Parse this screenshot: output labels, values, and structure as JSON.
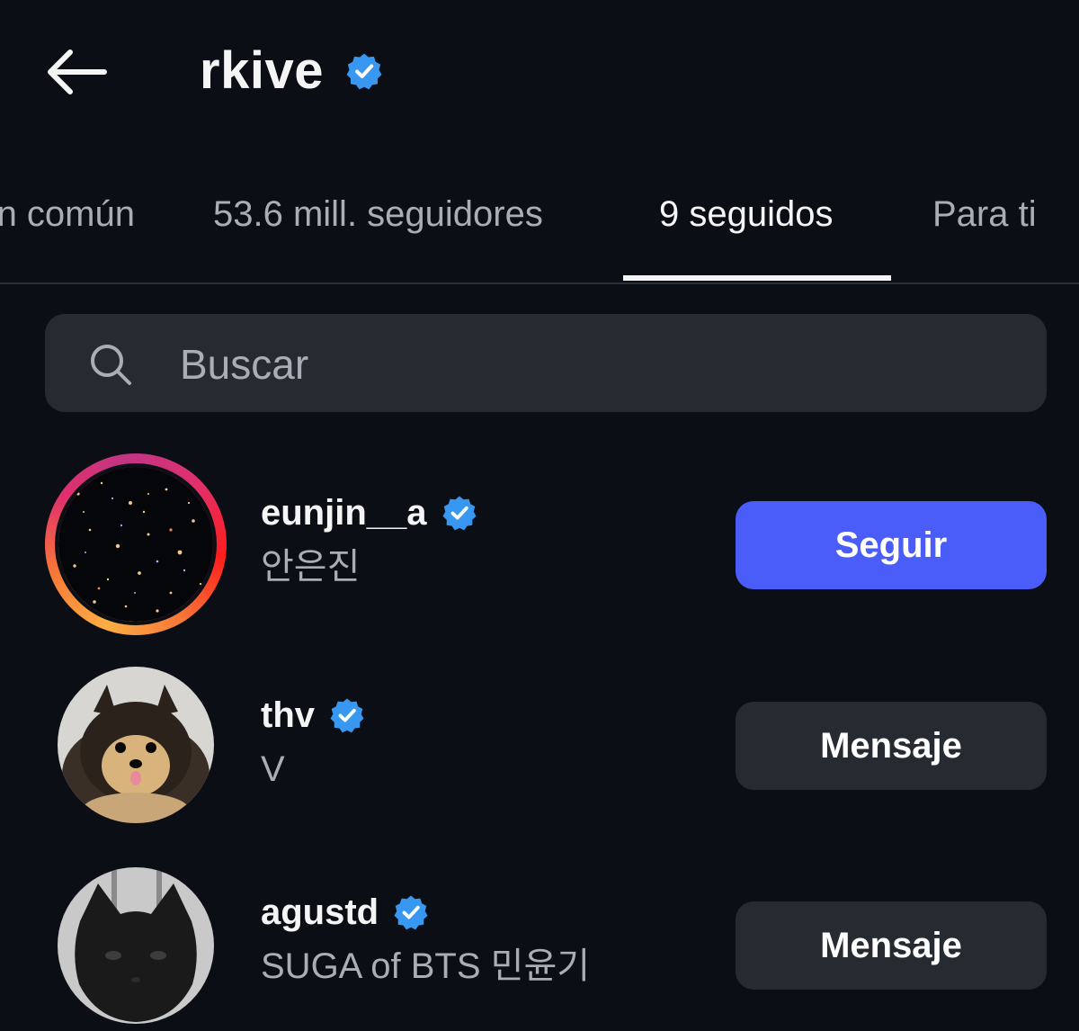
{
  "header": {
    "title": "rkive",
    "verified_icon": "verified-badge-icon",
    "back_icon": "arrow-left-icon"
  },
  "tabs": [
    {
      "label": "en común",
      "active": false
    },
    {
      "label": "53.6 mill. seguidores",
      "active": false
    },
    {
      "label": "9 seguidos",
      "active": true
    },
    {
      "label": "Para ti",
      "active": false
    }
  ],
  "search": {
    "placeholder": "Buscar",
    "value": ""
  },
  "users": [
    {
      "username": "eunjin__a",
      "fullname": "안은진",
      "verified": true,
      "button": "Seguir",
      "button_style": "primary",
      "story_ring": true
    },
    {
      "username": "thv",
      "fullname": "V",
      "verified": true,
      "button": "Mensaje",
      "button_style": "secondary",
      "story_ring": false
    },
    {
      "username": "agustd",
      "fullname": "SUGA of BTS 민윤기",
      "verified": true,
      "button": "Mensaje",
      "button_style": "secondary",
      "story_ring": false
    }
  ],
  "colors": {
    "background": "#0b0e14",
    "accent": "#4a5df9",
    "verified": "#3897f0",
    "muted_text": "#a9adb5",
    "surface": "#262a31"
  }
}
